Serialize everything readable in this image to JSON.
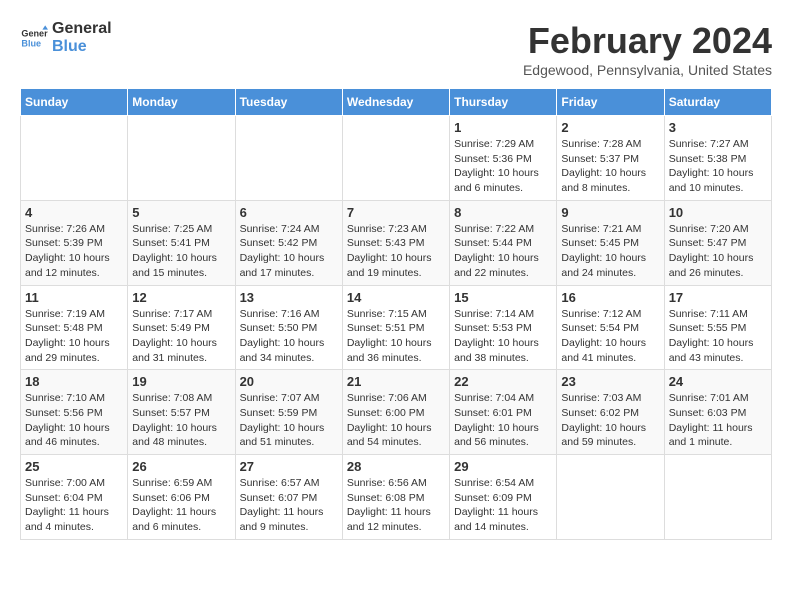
{
  "logo": {
    "line1": "General",
    "line2": "Blue"
  },
  "title": "February 2024",
  "location": "Edgewood, Pennsylvania, United States",
  "days_of_week": [
    "Sunday",
    "Monday",
    "Tuesday",
    "Wednesday",
    "Thursday",
    "Friday",
    "Saturday"
  ],
  "weeks": [
    [
      {
        "day": "",
        "info": ""
      },
      {
        "day": "",
        "info": ""
      },
      {
        "day": "",
        "info": ""
      },
      {
        "day": "",
        "info": ""
      },
      {
        "day": "1",
        "info": "Sunrise: 7:29 AM\nSunset: 5:36 PM\nDaylight: 10 hours\nand 6 minutes."
      },
      {
        "day": "2",
        "info": "Sunrise: 7:28 AM\nSunset: 5:37 PM\nDaylight: 10 hours\nand 8 minutes."
      },
      {
        "day": "3",
        "info": "Sunrise: 7:27 AM\nSunset: 5:38 PM\nDaylight: 10 hours\nand 10 minutes."
      }
    ],
    [
      {
        "day": "4",
        "info": "Sunrise: 7:26 AM\nSunset: 5:39 PM\nDaylight: 10 hours\nand 12 minutes."
      },
      {
        "day": "5",
        "info": "Sunrise: 7:25 AM\nSunset: 5:41 PM\nDaylight: 10 hours\nand 15 minutes."
      },
      {
        "day": "6",
        "info": "Sunrise: 7:24 AM\nSunset: 5:42 PM\nDaylight: 10 hours\nand 17 minutes."
      },
      {
        "day": "7",
        "info": "Sunrise: 7:23 AM\nSunset: 5:43 PM\nDaylight: 10 hours\nand 19 minutes."
      },
      {
        "day": "8",
        "info": "Sunrise: 7:22 AM\nSunset: 5:44 PM\nDaylight: 10 hours\nand 22 minutes."
      },
      {
        "day": "9",
        "info": "Sunrise: 7:21 AM\nSunset: 5:45 PM\nDaylight: 10 hours\nand 24 minutes."
      },
      {
        "day": "10",
        "info": "Sunrise: 7:20 AM\nSunset: 5:47 PM\nDaylight: 10 hours\nand 26 minutes."
      }
    ],
    [
      {
        "day": "11",
        "info": "Sunrise: 7:19 AM\nSunset: 5:48 PM\nDaylight: 10 hours\nand 29 minutes."
      },
      {
        "day": "12",
        "info": "Sunrise: 7:17 AM\nSunset: 5:49 PM\nDaylight: 10 hours\nand 31 minutes."
      },
      {
        "day": "13",
        "info": "Sunrise: 7:16 AM\nSunset: 5:50 PM\nDaylight: 10 hours\nand 34 minutes."
      },
      {
        "day": "14",
        "info": "Sunrise: 7:15 AM\nSunset: 5:51 PM\nDaylight: 10 hours\nand 36 minutes."
      },
      {
        "day": "15",
        "info": "Sunrise: 7:14 AM\nSunset: 5:53 PM\nDaylight: 10 hours\nand 38 minutes."
      },
      {
        "day": "16",
        "info": "Sunrise: 7:12 AM\nSunset: 5:54 PM\nDaylight: 10 hours\nand 41 minutes."
      },
      {
        "day": "17",
        "info": "Sunrise: 7:11 AM\nSunset: 5:55 PM\nDaylight: 10 hours\nand 43 minutes."
      }
    ],
    [
      {
        "day": "18",
        "info": "Sunrise: 7:10 AM\nSunset: 5:56 PM\nDaylight: 10 hours\nand 46 minutes."
      },
      {
        "day": "19",
        "info": "Sunrise: 7:08 AM\nSunset: 5:57 PM\nDaylight: 10 hours\nand 48 minutes."
      },
      {
        "day": "20",
        "info": "Sunrise: 7:07 AM\nSunset: 5:59 PM\nDaylight: 10 hours\nand 51 minutes."
      },
      {
        "day": "21",
        "info": "Sunrise: 7:06 AM\nSunset: 6:00 PM\nDaylight: 10 hours\nand 54 minutes."
      },
      {
        "day": "22",
        "info": "Sunrise: 7:04 AM\nSunset: 6:01 PM\nDaylight: 10 hours\nand 56 minutes."
      },
      {
        "day": "23",
        "info": "Sunrise: 7:03 AM\nSunset: 6:02 PM\nDaylight: 10 hours\nand 59 minutes."
      },
      {
        "day": "24",
        "info": "Sunrise: 7:01 AM\nSunset: 6:03 PM\nDaylight: 11 hours\nand 1 minute."
      }
    ],
    [
      {
        "day": "25",
        "info": "Sunrise: 7:00 AM\nSunset: 6:04 PM\nDaylight: 11 hours\nand 4 minutes."
      },
      {
        "day": "26",
        "info": "Sunrise: 6:59 AM\nSunset: 6:06 PM\nDaylight: 11 hours\nand 6 minutes."
      },
      {
        "day": "27",
        "info": "Sunrise: 6:57 AM\nSunset: 6:07 PM\nDaylight: 11 hours\nand 9 minutes."
      },
      {
        "day": "28",
        "info": "Sunrise: 6:56 AM\nSunset: 6:08 PM\nDaylight: 11 hours\nand 12 minutes."
      },
      {
        "day": "29",
        "info": "Sunrise: 6:54 AM\nSunset: 6:09 PM\nDaylight: 11 hours\nand 14 minutes."
      },
      {
        "day": "",
        "info": ""
      },
      {
        "day": "",
        "info": ""
      }
    ]
  ]
}
